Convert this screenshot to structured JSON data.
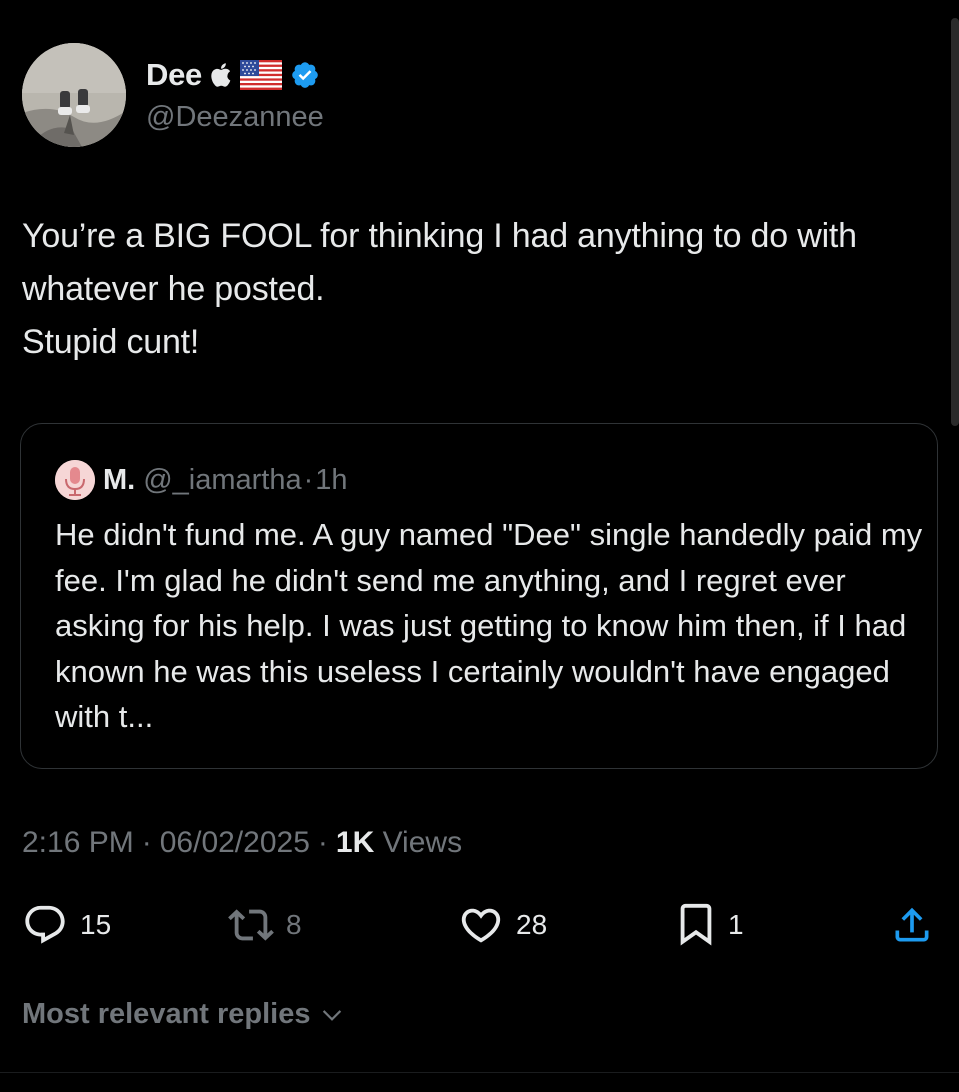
{
  "author": {
    "display_name": "Dee",
    "handle": "@Deezannee",
    "badges": [
      "apple-icon",
      "us-flag-icon",
      "verified-badge-icon"
    ],
    "verified_color": "#1d9bf0"
  },
  "tweet": {
    "text": "You’re a BIG FOOL for thinking I had anything to do with whatever he posted.\nStupid cunt!"
  },
  "quote": {
    "author_name": "M.",
    "author_handle": "@_iamartha",
    "separator": "·",
    "time": "1h",
    "avatar_icon": "microphone-icon",
    "text": "He didn't fund me. A guy named \"Dee\" single handedly paid my fee. I'm glad he didn't send me anything, and I regret ever asking for his help. I was just getting to know him then, if I had known he was this useless I certainly wouldn't have engaged with t..."
  },
  "meta": {
    "time": "2:16 PM",
    "sep1": "·",
    "date": "06/02/2025",
    "sep2": "·",
    "views_count": "1K",
    "views_label": "Views"
  },
  "actions": {
    "replies": "15",
    "reposts": "8",
    "likes": "28",
    "bookmarks": "1"
  },
  "footer": {
    "replies_sort_label": "Most relevant replies"
  },
  "colors": {
    "background": "#000000",
    "text_primary": "#e7e9ea",
    "text_secondary": "#71767b",
    "border": "#2f3336"
  }
}
